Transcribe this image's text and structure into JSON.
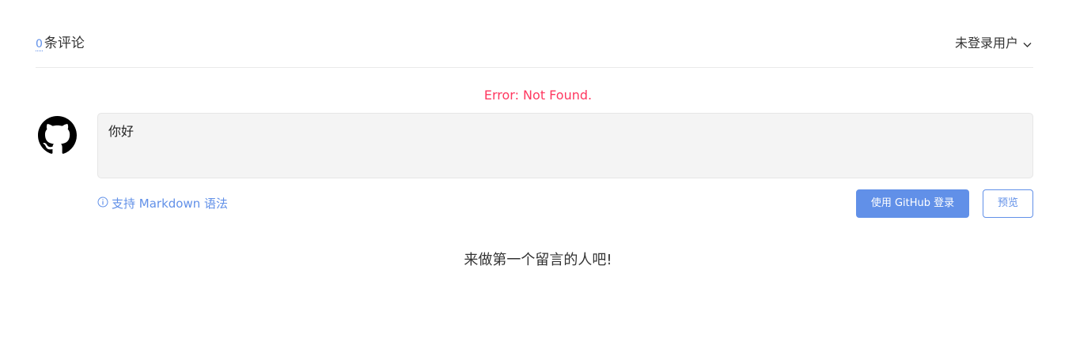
{
  "header": {
    "comment_count": "0",
    "comment_label": "条评论",
    "user_label": "未登录用户"
  },
  "error": {
    "message": "Error: Not Found."
  },
  "editor": {
    "avatar_icon": "github-icon",
    "textarea_value": "你好",
    "markdown_hint": "支持 Markdown 语法"
  },
  "buttons": {
    "login_label": "使用 GitHub 登录",
    "preview_label": "预览"
  },
  "comments": {
    "empty_message": "来做第一个留言的人吧!"
  },
  "colors": {
    "accent": "#6190e8",
    "error": "#ff3860",
    "textarea_bg": "#f4f4f4"
  }
}
